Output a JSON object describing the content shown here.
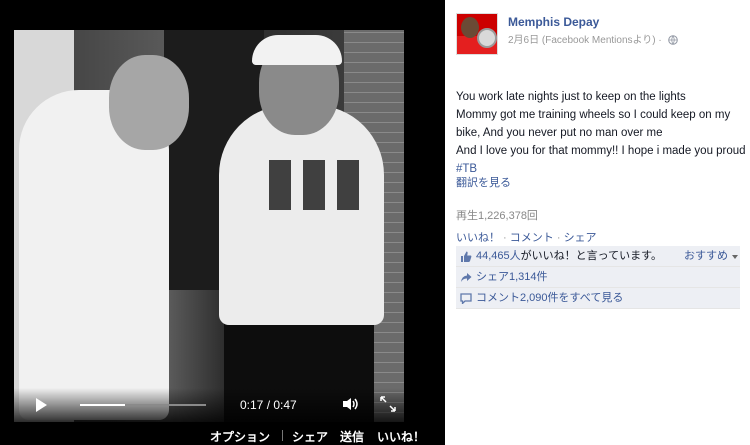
{
  "player": {
    "time_current": "0:17",
    "time_total": "0:47",
    "time_sep": " / ",
    "progress_fraction": 0.36
  },
  "bottom_bar": {
    "options": "オプション",
    "share": "シェア",
    "send": "送信",
    "like": "いいね！"
  },
  "post": {
    "author": "Memphis Depay",
    "date": "2月6日",
    "source": "(Facebook Mentionsより)",
    "meta_sep": " · ",
    "text_line1": "You work late nights just to keep on the lights",
    "text_line2": "Mommy got me training wheels so I could keep on my bike, And you never put no man over me",
    "text_line3": "And I love you for that mommy!! I hope i made you proud ",
    "hashtag": "#TB",
    "translate": "翻訳を見る",
    "views": "再生1,226,378回"
  },
  "actions": {
    "like": "いいね！",
    "comment": "コメント",
    "share": "シェア",
    "sep": " · "
  },
  "ufi": {
    "likes_link": "44,465人",
    "likes_suffix": "がいいね！と言っています。",
    "recommend": "おすすめ",
    "shares": "シェア1,314件",
    "comments": "コメント2,090件をすべて見る"
  },
  "colors": {
    "link": "#3b5998",
    "ufi_bg": "#edeff4",
    "theater_bg": "#000000"
  },
  "icons": [
    "play-icon",
    "volume-icon",
    "fullscreen-icon",
    "globe-icon",
    "thumbs-up-icon",
    "share-icon",
    "comment-icon",
    "chevron-down-icon"
  ]
}
